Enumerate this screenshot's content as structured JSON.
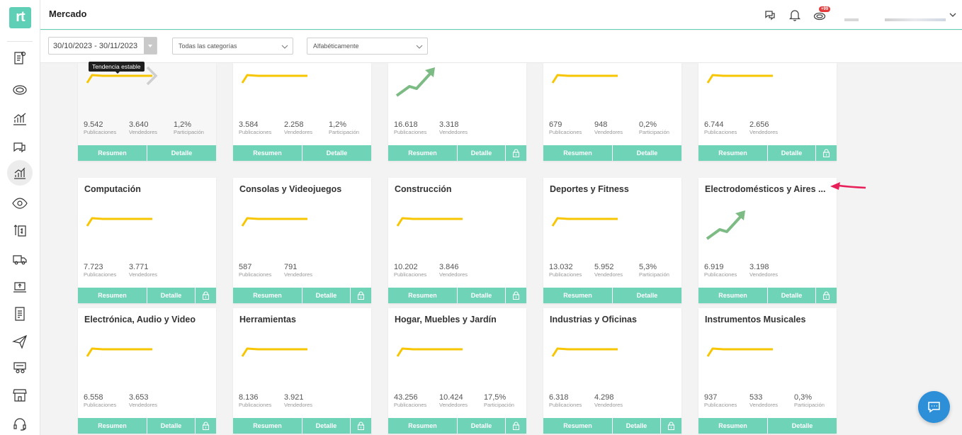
{
  "app": {
    "logo": "rt",
    "page_title": "Mercado",
    "notification_badge": "+99"
  },
  "sidebar": {
    "icons": [
      "reports-icon",
      "coin-icon",
      "chart-line-icon",
      "chat-bubbles-icon",
      "trend-chart-icon",
      "eye-icon",
      "money-transfer-icon",
      "delivery-truck-icon",
      "laptop-upload-icon",
      "document-list-icon",
      "send-icon",
      "user-list-icon",
      "store-icon",
      "headset-icon"
    ],
    "active": "trend-chart-icon"
  },
  "filters": {
    "date_range": "30/10/2023 - 30/11/2023",
    "category": "Todas las categorías",
    "sort": "Alfabéticamente"
  },
  "labels": {
    "publications": "Publicaciones",
    "sellers": "Vendedores",
    "participation": "Participación",
    "summary_button": "Resumen",
    "detail_button": "Detalle"
  },
  "tooltip": "Tendencia estable",
  "colors": {
    "accent": "#6ed3b7",
    "stable_trend": "#f7c600",
    "up_trend": "#7dbb84",
    "chat": "#2d8fd8"
  },
  "cards": [
    {
      "title": "",
      "trend": "stable",
      "publications": "9.542",
      "sellers": "3.640",
      "participation": "1,2%",
      "locked": false,
      "hovered": true
    },
    {
      "title": "",
      "trend": "stable",
      "publications": "3.584",
      "sellers": "2.258",
      "participation": "1,2%",
      "locked": false
    },
    {
      "title": "",
      "trend": "up",
      "publications": "16.618",
      "sellers": "3.318",
      "participation": "",
      "locked": true
    },
    {
      "title": "",
      "trend": "stable",
      "publications": "679",
      "sellers": "948",
      "participation": "0,2%",
      "locked": false
    },
    {
      "title": "",
      "trend": "stable",
      "publications": "6.744",
      "sellers": "2.656",
      "participation": "",
      "locked": true
    },
    {
      "title": "Computación",
      "trend": "stable",
      "publications": "7.723",
      "sellers": "3.771",
      "participation": "",
      "locked": true
    },
    {
      "title": "Consolas y Videojuegos",
      "trend": "stable",
      "publications": "587",
      "sellers": "791",
      "participation": "",
      "locked": true
    },
    {
      "title": "Construcción",
      "trend": "stable",
      "publications": "10.202",
      "sellers": "3.846",
      "participation": "",
      "locked": true
    },
    {
      "title": "Deportes y Fitness",
      "trend": "stable",
      "publications": "13.032",
      "sellers": "5.952",
      "participation": "5,3%",
      "locked": false
    },
    {
      "title": "Electrodomésticos y Aires ...",
      "trend": "up",
      "publications": "6.919",
      "sellers": "3.198",
      "participation": "",
      "locked": true
    },
    {
      "title": "Electrónica, Audio y Video",
      "trend": "stable",
      "publications": "6.558",
      "sellers": "3.653",
      "participation": "",
      "locked": true
    },
    {
      "title": "Herramientas",
      "trend": "stable",
      "publications": "8.136",
      "sellers": "3.921",
      "participation": "",
      "locked": true
    },
    {
      "title": "Hogar, Muebles y Jardín",
      "trend": "stable",
      "publications": "43.256",
      "sellers": "10.424",
      "participation": "17,5%",
      "locked": true
    },
    {
      "title": "Industrias y Oficinas",
      "trend": "stable",
      "publications": "6.318",
      "sellers": "4.298",
      "participation": "",
      "locked": true
    },
    {
      "title": "Instrumentos Musicales",
      "trend": "stable",
      "publications": "937",
      "sellers": "533",
      "participation": "0,3%",
      "locked": false
    }
  ]
}
